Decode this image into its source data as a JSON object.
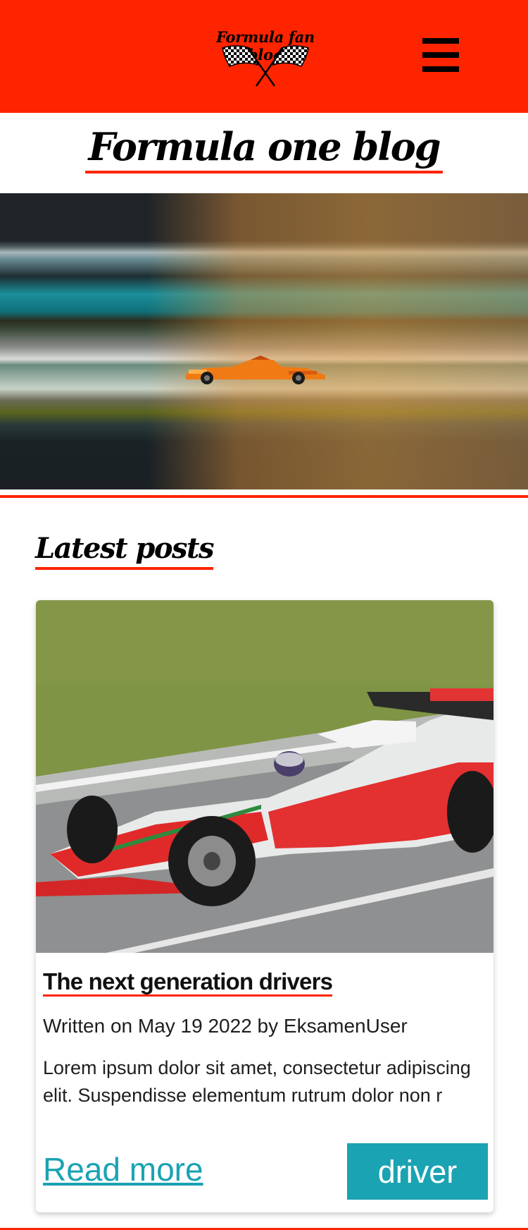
{
  "header": {
    "logo_text": "Formula fan blog",
    "logo_icon": "checkered-flags-icon",
    "menu_icon": "hamburger-menu-icon"
  },
  "page": {
    "title": "Formula one blog"
  },
  "hero": {
    "image": "motion-blurred-f1-car-photo"
  },
  "latest": {
    "title": "Latest posts",
    "posts": [
      {
        "image": "red-white-formula-car-photo",
        "title": "The next generation drivers",
        "meta": "Written on May 19 2022 by EksamenUser",
        "excerpt": "Lorem ipsum dolor sit amet, consectetur adipiscing elit. Suspendisse elementum rutrum dolor non r",
        "read_more": "Read more",
        "category": "driver"
      }
    ]
  },
  "colors": {
    "brand_red": "#ff2400",
    "accent_teal": "#1aa3b3",
    "text": "#1e1e1e"
  }
}
